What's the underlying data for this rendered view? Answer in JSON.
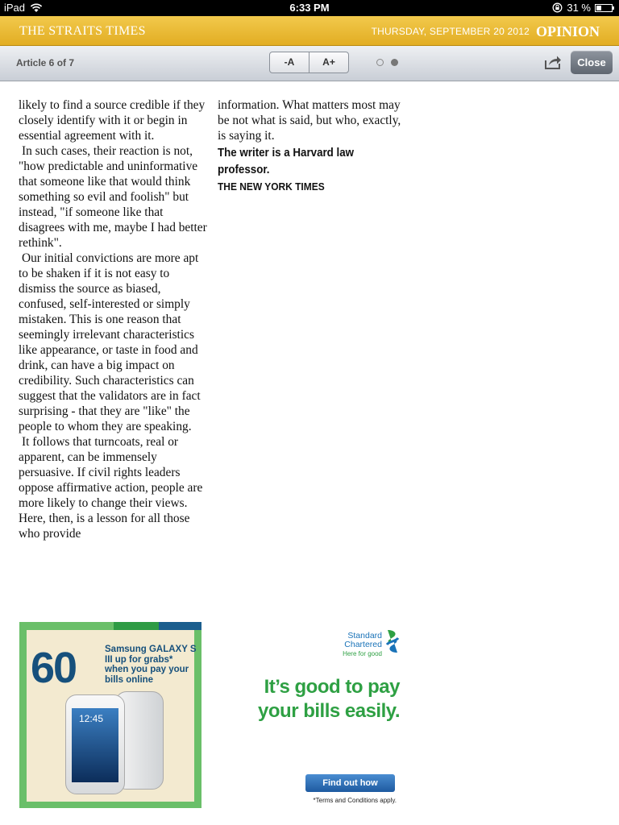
{
  "status_bar": {
    "device": "iPad",
    "time": "6:33 PM",
    "battery": "31 %",
    "battery_level": 0.31
  },
  "masthead": {
    "brand": "THE STRAITS TIMES",
    "date": "THURSDAY, SEPTEMBER 20 2012",
    "section": "OPINION",
    "color": "#e8b83a"
  },
  "toolbar": {
    "article_counter": "Article 6 of 7",
    "font_decrease": "-A",
    "font_increase": "A+",
    "close_label": "Close",
    "page_dots": 2,
    "active_dot": 2
  },
  "article": {
    "column1": [
      "likely to find a source credible if they closely identify with it or begin in essential agreement with it.",
      "In such cases, their reaction is not, \"how predictable and uninformative that someone like that would think something so evil and foolish\" but instead, \"if someone like that disagrees with me, maybe I had better rethink\".",
      "Our initial convictions are more apt to be shaken if it is not easy to dismiss the source as biased, confused, self-interested or simply mistaken. This is one reason that seemingly irrelevant characteristics like appearance, or taste in food and drink, can have a big impact on credibility. Such characteristics can suggest that the validators are in fact surprising - that they are \"like\" the people to whom they are speaking.",
      "It follows that turncoats, real or apparent, can be immensely persuasive. If civil rights leaders oppose affirmative action, people are more likely to change their views. Here, then, is a lesson for all those who provide"
    ],
    "column2_text": "information. What matters most may be not what is said, but who, exactly, is saying it.",
    "byline": "The writer is a Harvard law professor.",
    "source": "THE NEW YORK TIMES"
  },
  "ad": {
    "number": "60",
    "promo": "Samsung GALAXY S III up for grabs* when you pay your bills online",
    "phone_time": "12:45",
    "brand_line1": "Standard",
    "brand_line2": "Chartered",
    "brand_tagline": "Here for good",
    "headline_line1": "It’s good to pay",
    "headline_line2": "your bills easily.",
    "button": "Find out how",
    "terms": "*Terms and Conditions apply.",
    "green": "#2ea043",
    "blue": "#16507c"
  }
}
